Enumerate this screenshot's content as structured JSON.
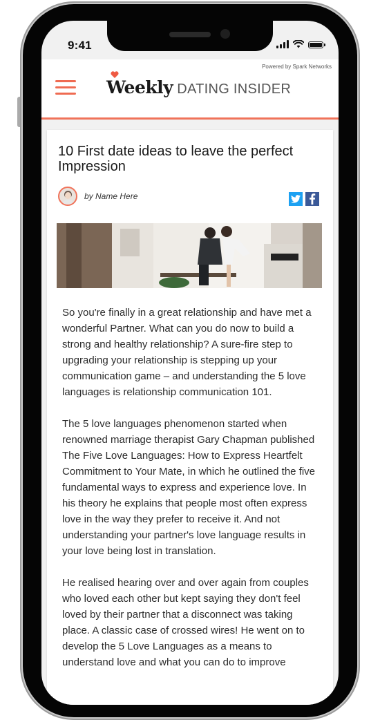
{
  "status_bar": {
    "time": "9:41"
  },
  "header": {
    "powered_by": "Powered by Spark Networks",
    "logo_weekly": "Weekly",
    "logo_dating": "DATING INSIDER"
  },
  "article": {
    "title": "10 First date ideas to leave the perfect Impression",
    "byline": "by Name Here",
    "paragraphs": [
      "So you're finally in a great relationship and have met a wonderful Partner. What can you do now to build a strong and healthy relationship? A sure-fire step to upgrading your relationship is stepping up your communication game – and understanding the 5 love languages is relationship communication 101.",
      "The 5 love languages phenomenon started when renowned marriage therapist Gary Chapman published The Five Love Languages: How to Express Heartfelt Commitment to Your Mate, in which he outlined the five fundamental ways to express and experience love. In his theory he explains that people most often express love in the way they prefer to receive it. And not understanding your partner's love language results in your love being lost in translation.",
      "He realised hearing over and over again from couples who loved each other but kept saying they don't feel loved by their partner that a disconnect was taking place. A classic case of crossed wires! He went on to develop the 5 Love Languages as a means to understand love and what you can do to improve"
    ]
  },
  "colors": {
    "accent": "#f0735a",
    "twitter": "#1da1f2",
    "facebook": "#3b5998"
  },
  "icons": {
    "menu": "hamburger-icon",
    "twitter": "twitter-icon",
    "facebook": "facebook-icon"
  }
}
